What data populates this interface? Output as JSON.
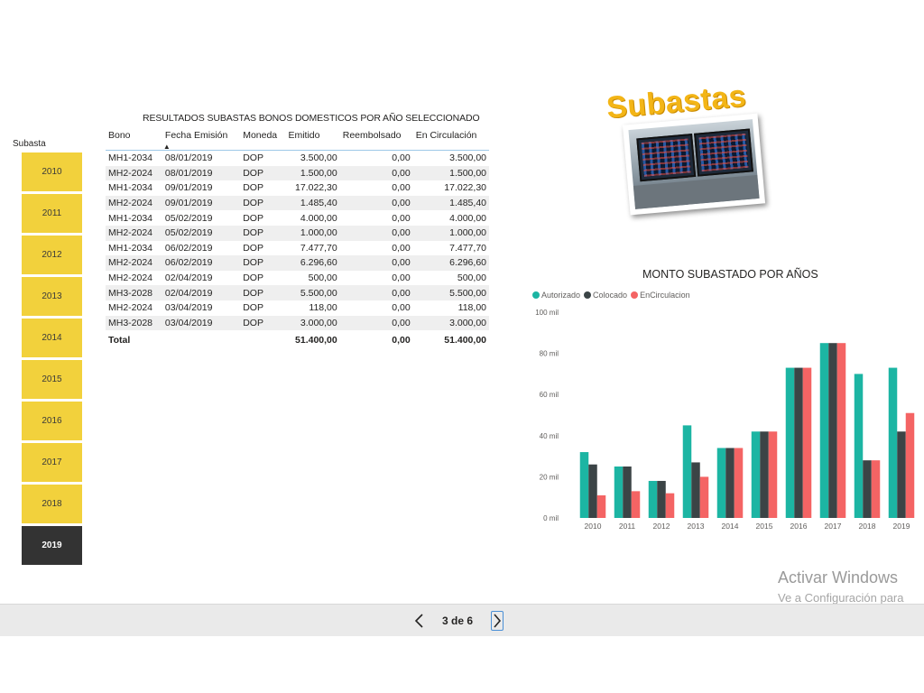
{
  "slicer": {
    "title": "Subasta",
    "years": [
      "2010",
      "2011",
      "2012",
      "2013",
      "2014",
      "2015",
      "2016",
      "2017",
      "2018",
      "2019"
    ],
    "selected": "2019",
    "color": "#F2D13C",
    "selected_color": "#333333"
  },
  "table": {
    "title": "RESULTADOS SUBASTAS BONOS DOMESTICOS POR  AÑO SELECCIONADO",
    "headers": [
      "Bono",
      "Fecha Emisión",
      "Moneda",
      "Emitido",
      "Reembolsado",
      "En Circulación"
    ],
    "sorted_column": "Fecha Emisión",
    "rows": [
      [
        "MH1-2034",
        "08/01/2019",
        "DOP",
        "3.500,00",
        "0,00",
        "3.500,00"
      ],
      [
        "MH2-2024",
        "08/01/2019",
        "DOP",
        "1.500,00",
        "0,00",
        "1.500,00"
      ],
      [
        "MH1-2034",
        "09/01/2019",
        "DOP",
        "17.022,30",
        "0,00",
        "17.022,30"
      ],
      [
        "MH2-2024",
        "09/01/2019",
        "DOP",
        "1.485,40",
        "0,00",
        "1.485,40"
      ],
      [
        "MH1-2034",
        "05/02/2019",
        "DOP",
        "4.000,00",
        "0,00",
        "4.000,00"
      ],
      [
        "MH2-2024",
        "05/02/2019",
        "DOP",
        "1.000,00",
        "0,00",
        "1.000,00"
      ],
      [
        "MH1-2034",
        "06/02/2019",
        "DOP",
        "7.477,70",
        "0,00",
        "7.477,70"
      ],
      [
        "MH2-2024",
        "06/02/2019",
        "DOP",
        "6.296,60",
        "0,00",
        "6.296,60"
      ],
      [
        "MH2-2024",
        "02/04/2019",
        "DOP",
        "500,00",
        "0,00",
        "500,00"
      ],
      [
        "MH3-2028",
        "02/04/2019",
        "DOP",
        "5.500,00",
        "0,00",
        "5.500,00"
      ],
      [
        "MH2-2024",
        "03/04/2019",
        "DOP",
        "118,00",
        "0,00",
        "118,00"
      ],
      [
        "MH3-2028",
        "03/04/2019",
        "DOP",
        "3.000,00",
        "0,00",
        "3.000,00"
      ]
    ],
    "total": [
      "Total",
      "",
      "",
      "51.400,00",
      "0,00",
      "51.400,00"
    ]
  },
  "logo": {
    "word": "Subastas",
    "photo_icon": "trading-monitors-photo",
    "color": "#F3B516"
  },
  "chart": {
    "title": "MONTO SUBASTADO POR AÑOS",
    "chart_data": {
      "type": "bar",
      "categories": [
        "2010",
        "2011",
        "2012",
        "2013",
        "2014",
        "2015",
        "2016",
        "2017",
        "2018",
        "2019"
      ],
      "series": [
        {
          "name": "Autorizado",
          "color": "#1CB5A3",
          "values": [
            32,
            25,
            18,
            45,
            34,
            42,
            73,
            85,
            70,
            73
          ]
        },
        {
          "name": "Colocado",
          "color": "#3B4446",
          "values": [
            26,
            25,
            18,
            27,
            34,
            42,
            73,
            85,
            28,
            42
          ]
        },
        {
          "name": "EnCirculacion",
          "color": "#F46464",
          "values": [
            11,
            13,
            12,
            20,
            34,
            42,
            73,
            85,
            28,
            51
          ]
        }
      ],
      "yticks": [
        "0 mil",
        "20 mil",
        "40 mil",
        "60 mil",
        "80 mil",
        "100 mil"
      ],
      "ylim": [
        0,
        100
      ],
      "legend": "top-left",
      "grid": false
    }
  },
  "watermark": {
    "line1": "Activar Windows",
    "line2": "Ve a Configuración para"
  },
  "navigation": {
    "page_label": "3 de 6",
    "prev_icon": "chevron-left-icon",
    "next_icon": "chevron-right-icon"
  }
}
